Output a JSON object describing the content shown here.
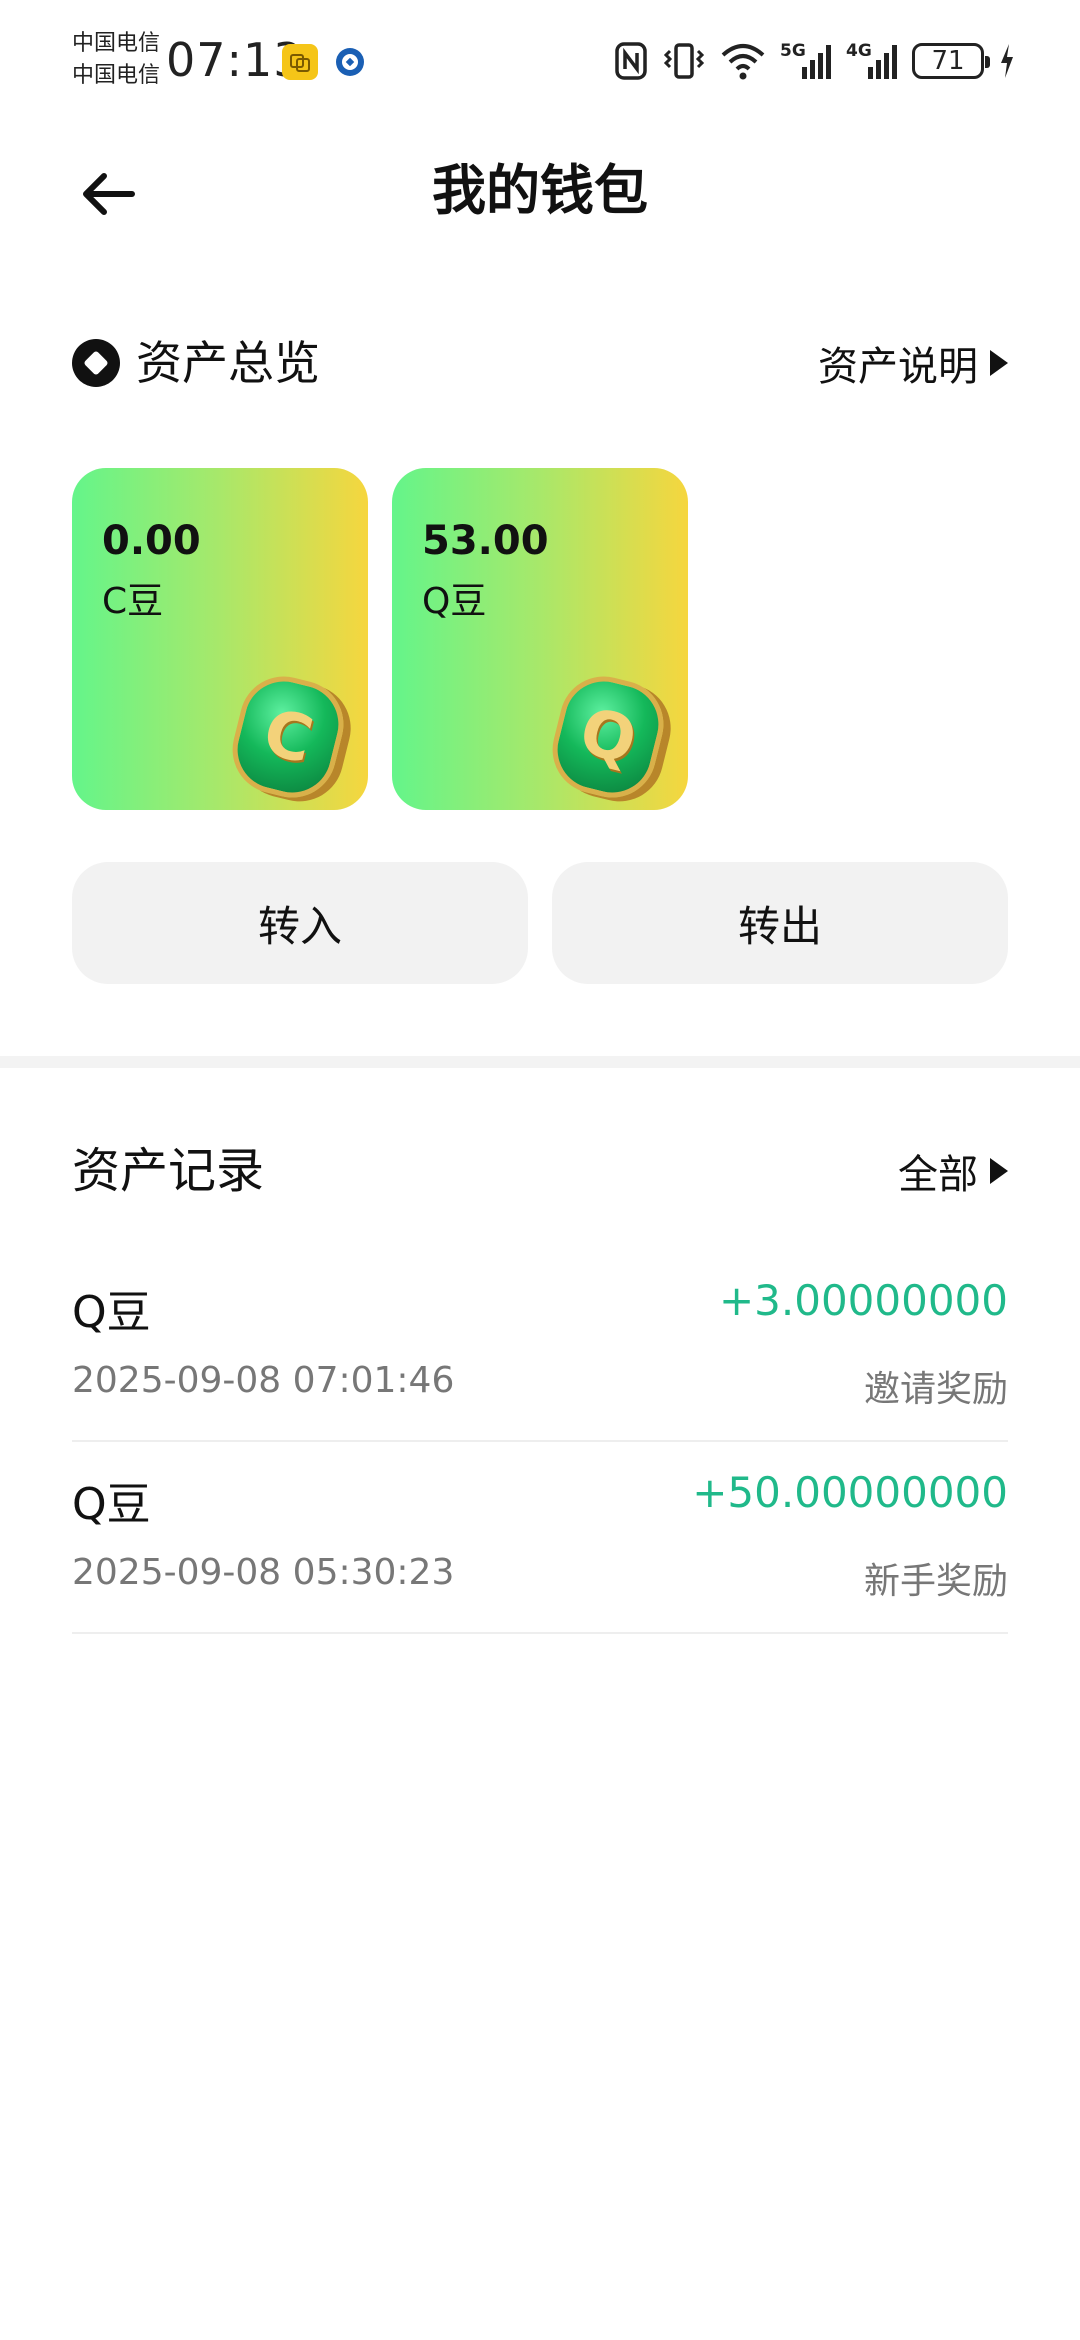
{
  "status_bar": {
    "carrier_1": "中国电信",
    "carrier_2": "中国电信",
    "time": "07:13",
    "net_5g": "5G",
    "net_4g": "4G",
    "battery": "71"
  },
  "header": {
    "title": "我的钱包"
  },
  "overview": {
    "title": "资产总览",
    "link": "资产说明",
    "cards": [
      {
        "amount": "0.00",
        "unit": "C豆",
        "coin_letter": "C"
      },
      {
        "amount": "53.00",
        "unit": "Q豆",
        "coin_letter": "Q"
      }
    ],
    "transfer_in": "转入",
    "transfer_out": "转出"
  },
  "records": {
    "title": "资产记录",
    "link": "全部",
    "items": [
      {
        "name": "Q豆",
        "amount": "+3.00000000",
        "time": "2025-09-08 07:01:46",
        "type": "邀请奖励"
      },
      {
        "name": "Q豆",
        "amount": "+50.00000000",
        "time": "2025-09-08 05:30:23",
        "type": "新手奖励"
      }
    ]
  },
  "colors": {
    "accent_green": "#20b98a",
    "card_gradient_start": "#64f58a",
    "card_gradient_end": "#f6d63e",
    "button_bg": "#f2f2f2"
  }
}
